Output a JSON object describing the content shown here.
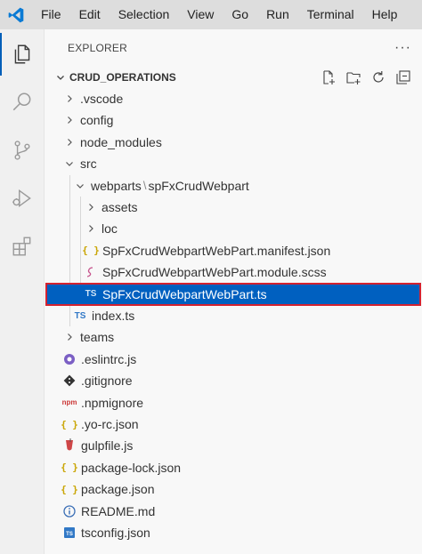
{
  "menubar": {
    "items": [
      "File",
      "Edit",
      "Selection",
      "View",
      "Go",
      "Run",
      "Terminal",
      "Help"
    ]
  },
  "activity_bar": {
    "icons": [
      "explorer-icon",
      "search-icon",
      "source-control-icon",
      "run-debug-icon",
      "extensions-icon"
    ]
  },
  "explorer": {
    "title": "EXPLORER",
    "more": "···",
    "section_title": "CRUD_OPERATIONS",
    "section_actions": [
      "new-file-icon",
      "new-folder-icon",
      "refresh-icon",
      "collapse-all-icon"
    ]
  },
  "tree": [
    {
      "label": ".vscode",
      "kind": "folder",
      "expanded": false,
      "depth": 0
    },
    {
      "label": "config",
      "kind": "folder",
      "expanded": false,
      "depth": 0
    },
    {
      "label": "node_modules",
      "kind": "folder",
      "expanded": false,
      "depth": 0
    },
    {
      "label": "src",
      "kind": "folder",
      "expanded": true,
      "depth": 0
    },
    {
      "label": "webparts",
      "label2": "spFxCrudWebpart",
      "separator": "\\",
      "kind": "folder",
      "expanded": true,
      "depth": 1
    },
    {
      "label": "assets",
      "kind": "folder",
      "expanded": false,
      "depth": 2
    },
    {
      "label": "loc",
      "kind": "folder",
      "expanded": false,
      "depth": 2
    },
    {
      "label": "SpFxCrudWebpartWebPart.manifest.json",
      "kind": "json",
      "depth": 2
    },
    {
      "label": "SpFxCrudWebpartWebPart.module.scss",
      "kind": "scss",
      "depth": 2
    },
    {
      "label": "SpFxCrudWebpartWebPart.ts",
      "kind": "ts",
      "depth": 2,
      "selected": true
    },
    {
      "label": "index.ts",
      "kind": "ts",
      "depth": 1
    },
    {
      "label": "teams",
      "kind": "folder",
      "expanded": false,
      "depth": 0
    },
    {
      "label": ".eslintrc.js",
      "kind": "eslint",
      "depth": 0
    },
    {
      "label": ".gitignore",
      "kind": "git",
      "depth": 0
    },
    {
      "label": ".npmignore",
      "kind": "npm",
      "depth": 0
    },
    {
      "label": ".yo-rc.json",
      "kind": "json",
      "depth": 0
    },
    {
      "label": "gulpfile.js",
      "kind": "gulp",
      "depth": 0
    },
    {
      "label": "package-lock.json",
      "kind": "json",
      "depth": 0
    },
    {
      "label": "package.json",
      "kind": "json",
      "depth": 0
    },
    {
      "label": "README.md",
      "kind": "info",
      "depth": 0
    },
    {
      "label": "tsconfig.json",
      "kind": "tsconfig",
      "depth": 0
    }
  ],
  "icon_glyphs": {
    "json": "{ }",
    "ts": "TS",
    "npm": "npm"
  },
  "colors": {
    "accent": "#005fb8",
    "selection": "#0060c0",
    "selection_outline": "#d32230",
    "json": "#c9a400",
    "ts": "#3178c6",
    "scss": "#c6538c",
    "eslint": "#7b5fc4",
    "gulp": "#cf4647",
    "npm": "#cb3837",
    "info": "#3b6fb6"
  }
}
